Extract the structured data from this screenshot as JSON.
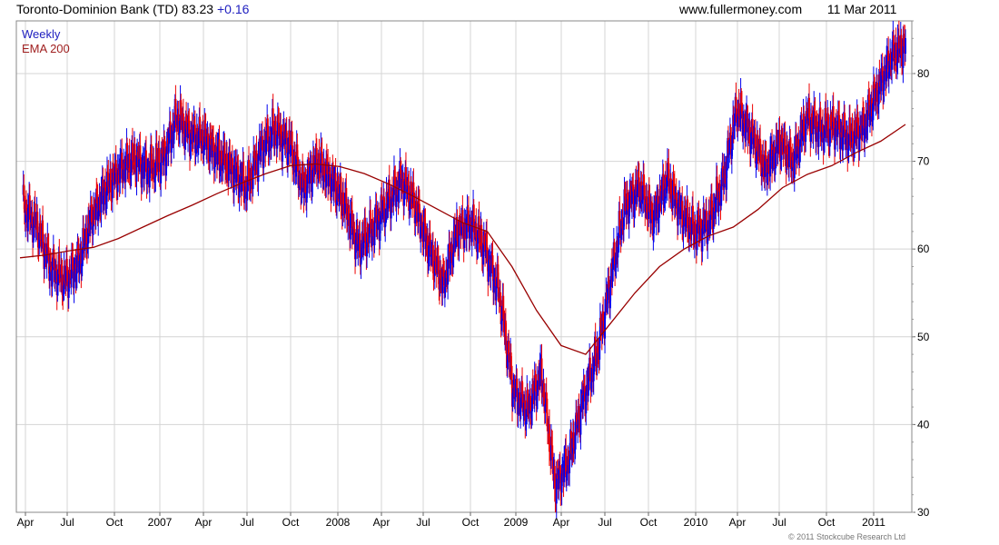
{
  "header": {
    "stock_title": "Toronto-Dominion Bank (TD)",
    "price": "83.23",
    "change": "+0.16",
    "website": "www.fullermoney.com",
    "date": "11 Mar 2011"
  },
  "copyright": "© 2011 Stockcube Research Ltd",
  "colors": {
    "up_candle": "#0000ee",
    "down_candle": "#ee0000",
    "ema_line": "#990000",
    "grid": "#d4d4d4",
    "legend_weekly": "#2020c0",
    "legend_ema": "#a02020"
  },
  "chart_data": {
    "type": "line",
    "title": "Toronto-Dominion Bank (TD)",
    "xlabel": "",
    "ylabel": "",
    "x": [
      "2006-04",
      "2006-07",
      "2006-10",
      "2007-01",
      "2007-04",
      "2007-07",
      "2007-10",
      "2008-01",
      "2008-04",
      "2008-07",
      "2008-10",
      "2009-01",
      "2009-03",
      "2009-04",
      "2009-07",
      "2009-10",
      "2010-01",
      "2010-04",
      "2010-07",
      "2010-10",
      "2011-01",
      "2011-03"
    ],
    "x_tick_labels": [
      "Apr",
      "Jul",
      "Oct",
      "2007",
      "Apr",
      "Jul",
      "Oct",
      "2008",
      "Apr",
      "Jul",
      "Oct",
      "2009",
      "Apr",
      "Jul",
      "Oct",
      "2010",
      "Apr",
      "Jul",
      "Oct",
      "2011"
    ],
    "y_ticks": [
      30,
      40,
      50,
      60,
      70,
      80
    ],
    "ylim": [
      30,
      86
    ],
    "grid": true,
    "legend": {
      "placement": "top-left",
      "entries": [
        "Weekly",
        "EMA 200"
      ]
    },
    "series": [
      {
        "name": "Weekly",
        "style": "candlestick-weekly",
        "values": [
          65.2,
          62.5,
          58.0,
          56.3,
          58.5,
          64.0,
          67.0,
          69.2,
          70.2,
          69.0,
          70.2,
          75.0,
          73.0,
          72.5,
          70.5,
          69.0,
          67.0,
          71.5,
          73.5,
          72.0,
          67.0,
          70.0,
          68.0,
          65.0,
          60.0,
          62.5,
          65.0,
          68.0,
          65.0,
          60.0,
          56.0,
          62.0,
          63.0,
          60.0,
          55.0,
          44.0,
          41.5,
          46.0,
          33.0,
          36.0,
          43.0,
          48.0,
          57.0,
          65.0,
          67.0,
          63.5,
          68.0,
          64.0,
          62.0,
          63.0,
          68.0,
          76.0,
          73.0,
          69.0,
          72.0,
          70.0,
          75.0,
          73.5,
          74.0,
          72.5,
          74.0,
          78.0,
          82.0,
          83.2
        ]
      },
      {
        "name": "EMA 200",
        "values": [
          59.0,
          59.3,
          59.8,
          60.2,
          61.2,
          62.5,
          63.8,
          65.0,
          66.3,
          67.5,
          68.6,
          69.5,
          69.7,
          69.4,
          68.6,
          67.4,
          66.0,
          64.5,
          63.0,
          62.0,
          58.0,
          53.0,
          49.0,
          48.0,
          51.5,
          55.0,
          58.0,
          60.0,
          61.5,
          62.5,
          64.5,
          67.0,
          68.5,
          69.5,
          71.0,
          72.3,
          74.2
        ]
      }
    ]
  }
}
